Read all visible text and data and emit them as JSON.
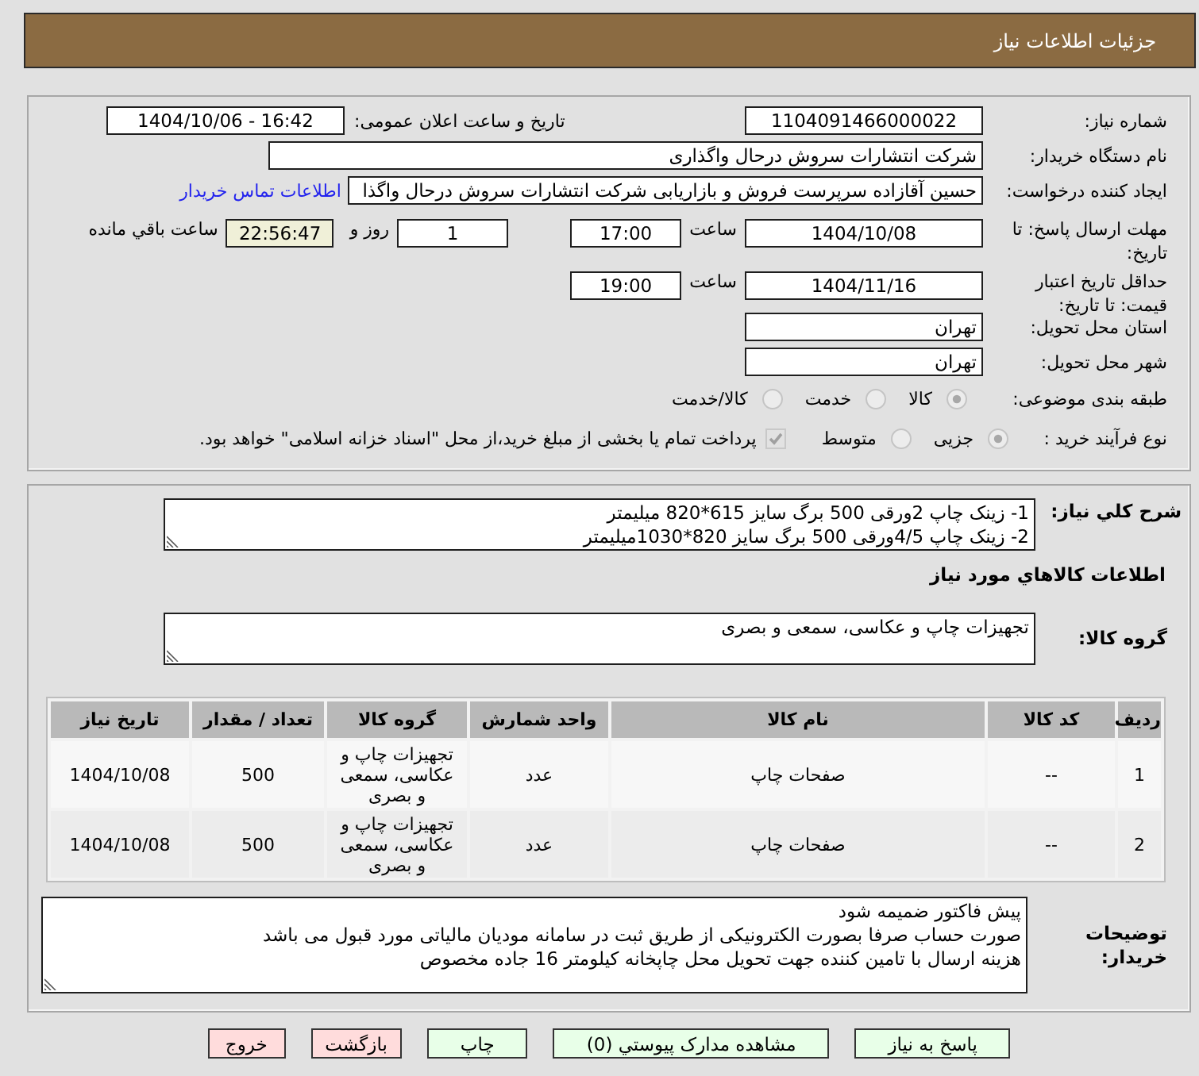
{
  "header": {
    "title": "جزئیات اطلاعات نیاز"
  },
  "details": {
    "need_number": {
      "label": "شماره نیاز:",
      "value": "1104091466000022"
    },
    "announcement": {
      "label": "تاریخ و ساعت اعلان عمومی:",
      "value": "1404/10/06 - 16:42"
    },
    "buyer_org": {
      "label": "نام دستگاه خریدار:",
      "value": "شرکت انتشارات سروش  درحال واگذاری"
    },
    "requester": {
      "label": "ایجاد کننده درخواست:",
      "value": "حسین آقازاده سرپرست فروش و بازاریابی شرکت انتشارات سروش  درحال واگذا",
      "contact_link": "اطلاعات تماس خریدار"
    },
    "reply_deadline": {
      "label": "مهلت ارسال پاسخ: تا تاریخ:",
      "date": "1404/10/08",
      "time_label": "ساعت",
      "time": "17:00",
      "days": "1",
      "days_label": "روز و",
      "remaining": "22:56:47",
      "remaining_label": "ساعت باقي مانده"
    },
    "price_validity": {
      "label": "حداقل تاریخ اعتبار قیمت: تا تاریخ:",
      "date": "1404/11/16",
      "time_label": "ساعت",
      "time": "19:00"
    },
    "province": {
      "label": "استان محل تحویل:",
      "value": "تهران"
    },
    "city": {
      "label": "شهر محل تحویل:",
      "value": "تهران"
    },
    "category": {
      "label": "طبقه بندی موضوعی:",
      "options": [
        {
          "label": "کالا",
          "selected": true
        },
        {
          "label": "خدمت",
          "selected": false
        },
        {
          "label": "کالا/خدمت",
          "selected": false
        }
      ]
    },
    "purchase_type": {
      "label": "نوع فرآیند خرید :",
      "options": [
        {
          "label": "جزیی",
          "selected": true
        },
        {
          "label": "متوسط",
          "selected": false
        }
      ],
      "treasury": {
        "label": "پرداخت تمام یا بخشی از مبلغ خرید،از محل \"اسناد خزانه اسلامی\" خواهد بود.",
        "checked": true
      }
    }
  },
  "need": {
    "summary_label": "شرح کلي نیاز:",
    "summary_lines": [
      "1- زینک چاپ 2ورقی 500 برگ سایز 615*820 میلیمتر",
      "2- زینک چاپ 4/5ورقی 500 برگ سایز 820*1030میلیمتر"
    ],
    "goods_title": "اطلاعات کالاهاي مورد نیاز",
    "group_label": "گروه کالا:",
    "group_value": "تجهیزات چاپ و عکاسی، سمعی و بصری"
  },
  "table": {
    "columns": [
      "ردیف",
      "کد کالا",
      "نام کالا",
      "واحد شمارش",
      "گروه کالا",
      "تعداد / مقدار",
      "تاریخ نیاز"
    ],
    "rows": [
      [
        "1",
        "--",
        "صفحات چاپ",
        "عدد",
        "تجهیزات چاپ و عکاسی، سمعی و بصری",
        "500",
        "1404/10/08"
      ],
      [
        "2",
        "--",
        "صفحات چاپ",
        "عدد",
        "تجهیزات چاپ و عکاسی، سمعی و بصری",
        "500",
        "1404/10/08"
      ]
    ]
  },
  "buyer_notes": {
    "label": "توضیحات خریدار:",
    "lines": [
      "پیش فاکتور ضمیمه شود",
      "صورت حساب صرفا بصورت الکترونیکی از طریق ثبت در سامانه مودیان مالیاتی مورد قبول می باشد",
      "هزینه ارسال با تامین کننده جهت تحویل محل چاپخانه کیلومتر 16 جاده مخصوص"
    ]
  },
  "buttons": [
    {
      "label": "پاسخ به نیاز",
      "kind": "action"
    },
    {
      "label": "مشاهده مدارک پیوستي (0)",
      "kind": "action"
    },
    {
      "label": "چاپ",
      "kind": "action"
    },
    {
      "label": "بازگشت",
      "kind": "exit"
    },
    {
      "label": "خروج",
      "kind": "exit"
    }
  ]
}
